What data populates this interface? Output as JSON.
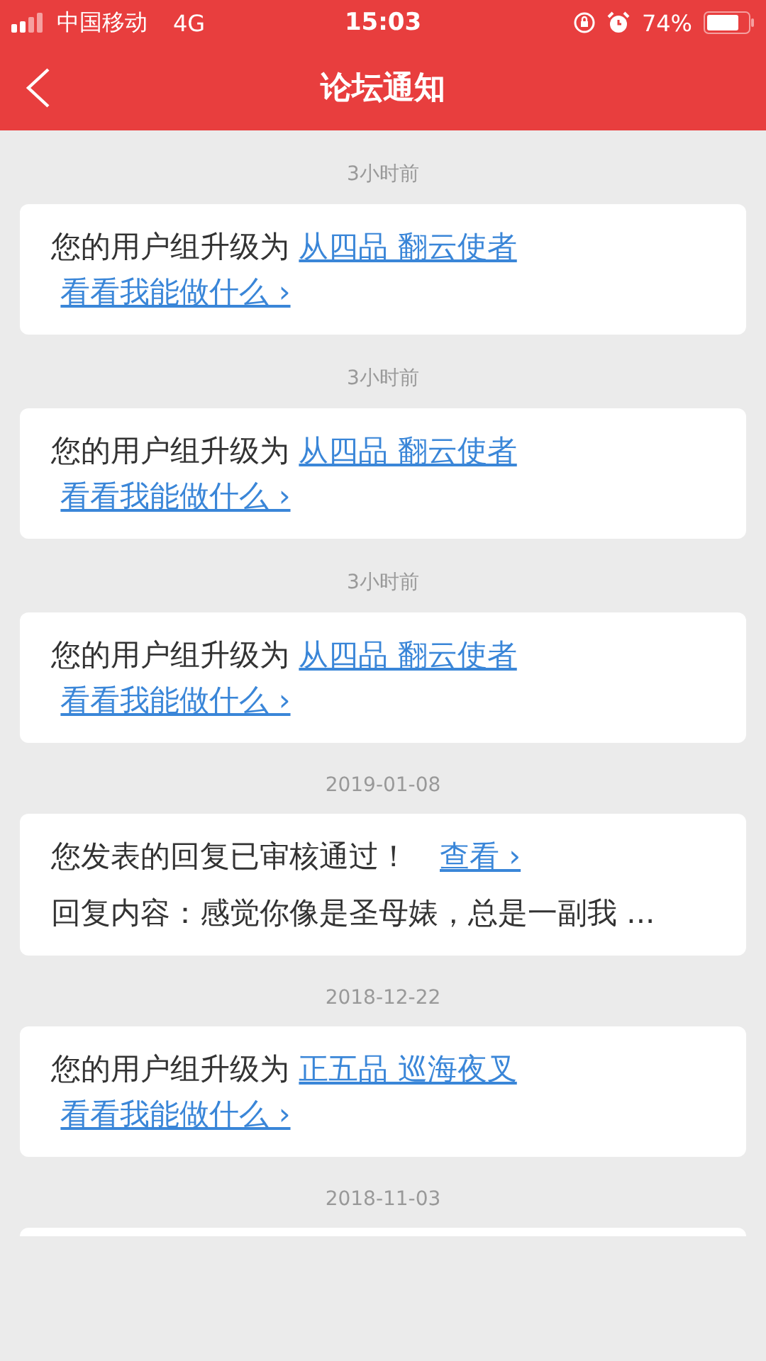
{
  "status_bar": {
    "carrier": "中国移动",
    "network": "4G",
    "time": "15:03",
    "battery": "74%"
  },
  "nav": {
    "title": "论坛通知"
  },
  "notifications": [
    {
      "time": "3小时前",
      "kind": "upgrade",
      "text": "您的用户组升级为",
      "group": "从四品 翻云使者",
      "link": "看看我能做什么 ›"
    },
    {
      "time": "3小时前",
      "kind": "upgrade",
      "text": "您的用户组升级为",
      "group": "从四品 翻云使者",
      "link": "看看我能做什么 ›"
    },
    {
      "time": "3小时前",
      "kind": "upgrade",
      "text": "您的用户组升级为",
      "group": "从四品 翻云使者",
      "link": "看看我能做什么 ›"
    },
    {
      "time": "2019-01-08",
      "kind": "reply",
      "text": "您发表的回复已审核通过！",
      "link": "查看 ›",
      "content": "回复内容：感觉你像是圣母婊，总是一副我 ..."
    },
    {
      "time": "2018-12-22",
      "kind": "upgrade",
      "text": "您的用户组升级为",
      "group": "正五品 巡海夜叉",
      "link": "看看我能做什么 ›"
    },
    {
      "time": "2018-11-03",
      "kind": "clipped"
    }
  ]
}
